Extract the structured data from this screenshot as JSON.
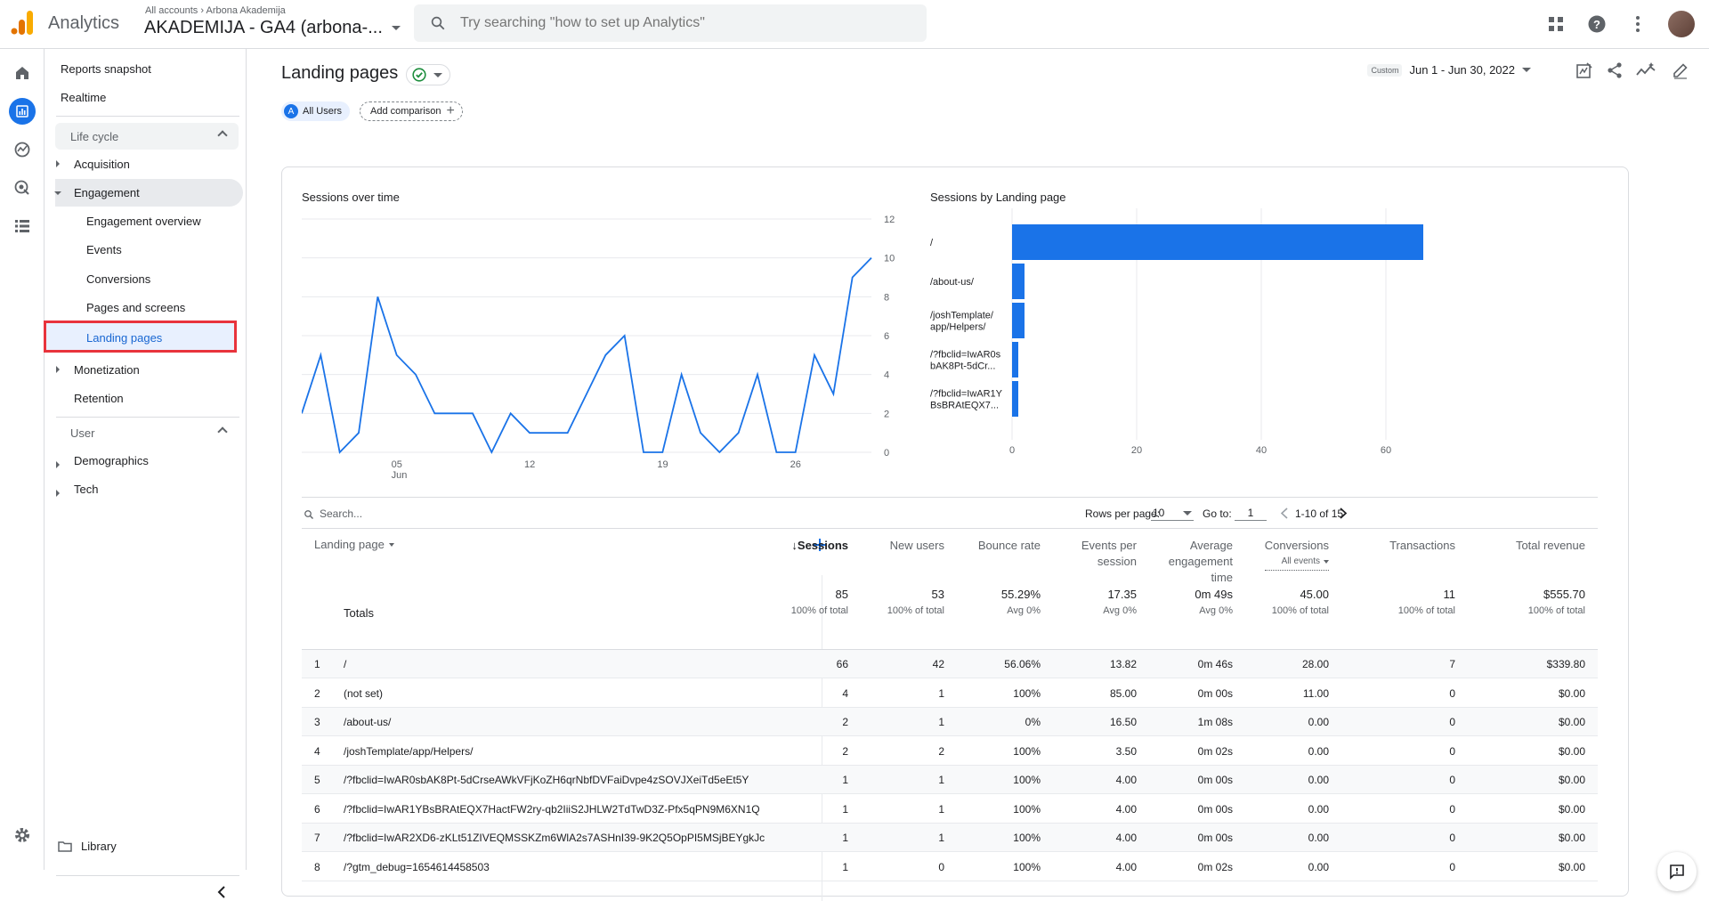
{
  "app": {
    "brand": "Analytics",
    "breadcrumb_root": "All accounts",
    "breadcrumb_account": "Arbona Akademija",
    "property": "AKADEMIJA - GA4 (arbona-..."
  },
  "search": {
    "placeholder": "Try searching \"how to set up Analytics\""
  },
  "sidebar": {
    "reports_snapshot": "Reports snapshot",
    "realtime": "Realtime",
    "lifecycle": "Life cycle",
    "acquisition": "Acquisition",
    "engagement": "Engagement",
    "engagement_overview": "Engagement overview",
    "events": "Events",
    "conversions": "Conversions",
    "pages_screens": "Pages and screens",
    "landing_pages": "Landing pages",
    "monetization": "Monetization",
    "retention": "Retention",
    "user": "User",
    "demographics": "Demographics",
    "tech": "Tech",
    "library": "Library"
  },
  "header": {
    "title": "Landing pages",
    "segment": "All Users",
    "segment_letter": "A",
    "add_comparison": "Add comparison",
    "date_tag": "Custom",
    "date_range": "Jun 1 - Jun 30, 2022"
  },
  "line_chart": {
    "title": "Sessions over time",
    "x_ticks": [
      "05",
      "12",
      "19",
      "26"
    ],
    "x_month": "Jun",
    "y_ticks": [
      "12",
      "10",
      "8",
      "6",
      "4",
      "2",
      "0"
    ]
  },
  "bar_chart": {
    "title": "Sessions by Landing page",
    "x_ticks": [
      "0",
      "20",
      "40",
      "60"
    ]
  },
  "chart_data": [
    {
      "type": "line",
      "title": "Sessions over time",
      "x": [
        1,
        2,
        3,
        4,
        5,
        6,
        7,
        8,
        9,
        10,
        11,
        12,
        13,
        14,
        15,
        16,
        17,
        18,
        19,
        20,
        21,
        22,
        23,
        24,
        25,
        26,
        27,
        28,
        29,
        30
      ],
      "values": [
        2,
        5,
        0,
        1,
        8,
        5,
        4,
        2,
        2,
        2,
        0,
        2,
        1,
        1,
        1,
        3,
        5,
        6,
        0,
        0,
        4,
        1,
        0,
        1,
        4,
        0,
        0,
        5,
        3,
        9,
        10
      ],
      "ylim": [
        0,
        12
      ]
    },
    {
      "type": "bar",
      "title": "Sessions by Landing page",
      "categories": [
        "/",
        "/about-us/",
        "/joshTemplate/app/Helpers/",
        "/?fbclid=IwAR0sbAK8Pt-5dCr...",
        "/?fbclid=IwAR1YBsBRAtEQX7..."
      ],
      "category_labels": [
        [
          "/"
        ],
        [
          "/about-us/"
        ],
        [
          "/joshTemplate/",
          "app/Helpers/"
        ],
        [
          "/?fbclid=IwAR0s",
          "bAK8Pt-5dCr..."
        ],
        [
          "/?fbclid=IwAR1Y",
          "BsBRAtEQX7..."
        ]
      ],
      "values": [
        66,
        2,
        2,
        1,
        1
      ],
      "xlim": [
        0,
        70
      ]
    }
  ],
  "table_controls": {
    "search_placeholder": "Search...",
    "rows_label": "Rows per page:",
    "rows_value": "10",
    "goto_label": "Go to:",
    "goto_value": "1",
    "range": "1-10 of 15"
  },
  "table": {
    "dim_header": "Landing page",
    "headers": {
      "sessions": "↓Sessions",
      "new_users": "New users",
      "bounce": "Bounce rate",
      "events1": "Events per",
      "events2": "session",
      "avg1": "Average",
      "avg2": "engagement",
      "avg3": "time",
      "conv": "Conversions",
      "conv_sub": "All events",
      "trans": "Transactions",
      "rev": "Total revenue"
    },
    "totals": {
      "label": "Totals",
      "sessions": "85",
      "sessions_sub": "100% of total",
      "new_users": "53",
      "new_users_sub": "100% of total",
      "bounce": "55.29%",
      "bounce_sub": "Avg 0%",
      "events": "17.35",
      "events_sub": "Avg 0%",
      "avg": "0m 49s",
      "avg_sub": "Avg 0%",
      "conv": "45.00",
      "conv_sub": "100% of total",
      "trans": "11",
      "trans_sub": "100% of total",
      "rev": "$555.70",
      "rev_sub": "100% of total"
    },
    "rows": [
      {
        "n": "1",
        "page": "/",
        "sessions": "66",
        "new_users": "42",
        "bounce": "56.06%",
        "events": "13.82",
        "avg": "0m 46s",
        "conv": "28.00",
        "trans": "7",
        "rev": "$339.80"
      },
      {
        "n": "2",
        "page": "(not set)",
        "sessions": "4",
        "new_users": "1",
        "bounce": "100%",
        "events": "85.00",
        "avg": "0m 00s",
        "conv": "11.00",
        "trans": "0",
        "rev": "$0.00"
      },
      {
        "n": "3",
        "page": "/about-us/",
        "sessions": "2",
        "new_users": "1",
        "bounce": "0%",
        "events": "16.50",
        "avg": "1m 08s",
        "conv": "0.00",
        "trans": "0",
        "rev": "$0.00"
      },
      {
        "n": "4",
        "page": "/joshTemplate/app/Helpers/",
        "sessions": "2",
        "new_users": "2",
        "bounce": "100%",
        "events": "3.50",
        "avg": "0m 02s",
        "conv": "0.00",
        "trans": "0",
        "rev": "$0.00"
      },
      {
        "n": "5",
        "page": "/?fbclid=IwAR0sbAK8Pt-5dCrseAWkVFjKoZH6qrNbfDVFaiDvpe4zSOVJXeiTd5eEt5Y",
        "sessions": "1",
        "new_users": "1",
        "bounce": "100%",
        "events": "4.00",
        "avg": "0m 00s",
        "conv": "0.00",
        "trans": "0",
        "rev": "$0.00"
      },
      {
        "n": "6",
        "page": "/?fbclid=IwAR1YBsBRAtEQX7HactFW2ry-qb2IiiS2JHLW2TdTwD3Z-Pfx5qPN9M6XN1Q",
        "sessions": "1",
        "new_users": "1",
        "bounce": "100%",
        "events": "4.00",
        "avg": "0m 00s",
        "conv": "0.00",
        "trans": "0",
        "rev": "$0.00"
      },
      {
        "n": "7",
        "page": "/?fbclid=IwAR2XD6-zKLt51ZIVEQMSSKZm6WlA2s7ASHnI39-9K2Q5OpPI5MSjBEYgkJc",
        "sessions": "1",
        "new_users": "1",
        "bounce": "100%",
        "events": "4.00",
        "avg": "0m 00s",
        "conv": "0.00",
        "trans": "0",
        "rev": "$0.00"
      },
      {
        "n": "8",
        "page": "/?gtm_debug=1654614458503",
        "sessions": "1",
        "new_users": "0",
        "bounce": "100%",
        "events": "4.00",
        "avg": "0m 02s",
        "conv": "0.00",
        "trans": "0",
        "rev": "$0.00"
      }
    ]
  },
  "colors": {
    "accent": "#1a73e8",
    "highlight": "#e8333c"
  }
}
